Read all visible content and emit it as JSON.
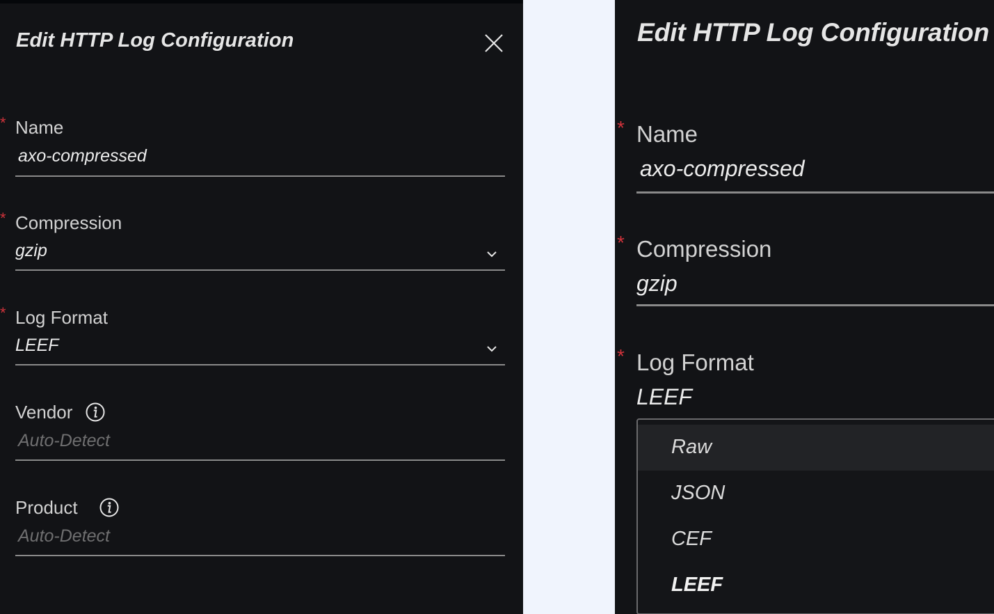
{
  "left_panel": {
    "title": "Edit HTTP Log Configuration",
    "fields": {
      "name": {
        "label": "Name",
        "required_marker": "*",
        "value": "axo-compressed"
      },
      "compression": {
        "label": "Compression",
        "required_marker": "*",
        "value": "gzip"
      },
      "log_format": {
        "label": "Log Format",
        "required_marker": "*",
        "value": "LEEF"
      },
      "vendor": {
        "label": "Vendor",
        "placeholder": "Auto-Detect"
      },
      "product": {
        "label": "Product",
        "placeholder": "Auto-Detect"
      }
    },
    "icons": {
      "close": "close-icon",
      "info": "info-icon",
      "dropdown": "chevron-down-icon"
    }
  },
  "right_panel": {
    "title": "Edit HTTP Log Configuration",
    "fields": {
      "name": {
        "label": "Name",
        "required_marker": "*",
        "value": "axo-compressed"
      },
      "compression": {
        "label": "Compression",
        "required_marker": "*",
        "value": "gzip"
      },
      "log_format": {
        "label": "Log Format",
        "required_marker": "*",
        "value": "LEEF"
      }
    },
    "log_format_options": [
      "Raw",
      "JSON",
      "CEF",
      "LEEF"
    ],
    "hovered_option": "Raw",
    "selected_option": "LEEF"
  },
  "colors": {
    "panel_bg": "#121316",
    "page_bg": "#f0f4fd",
    "required": "#d0333b",
    "text": "#ececec",
    "placeholder": "#6f6f70",
    "underline": "#8a8a8a"
  }
}
